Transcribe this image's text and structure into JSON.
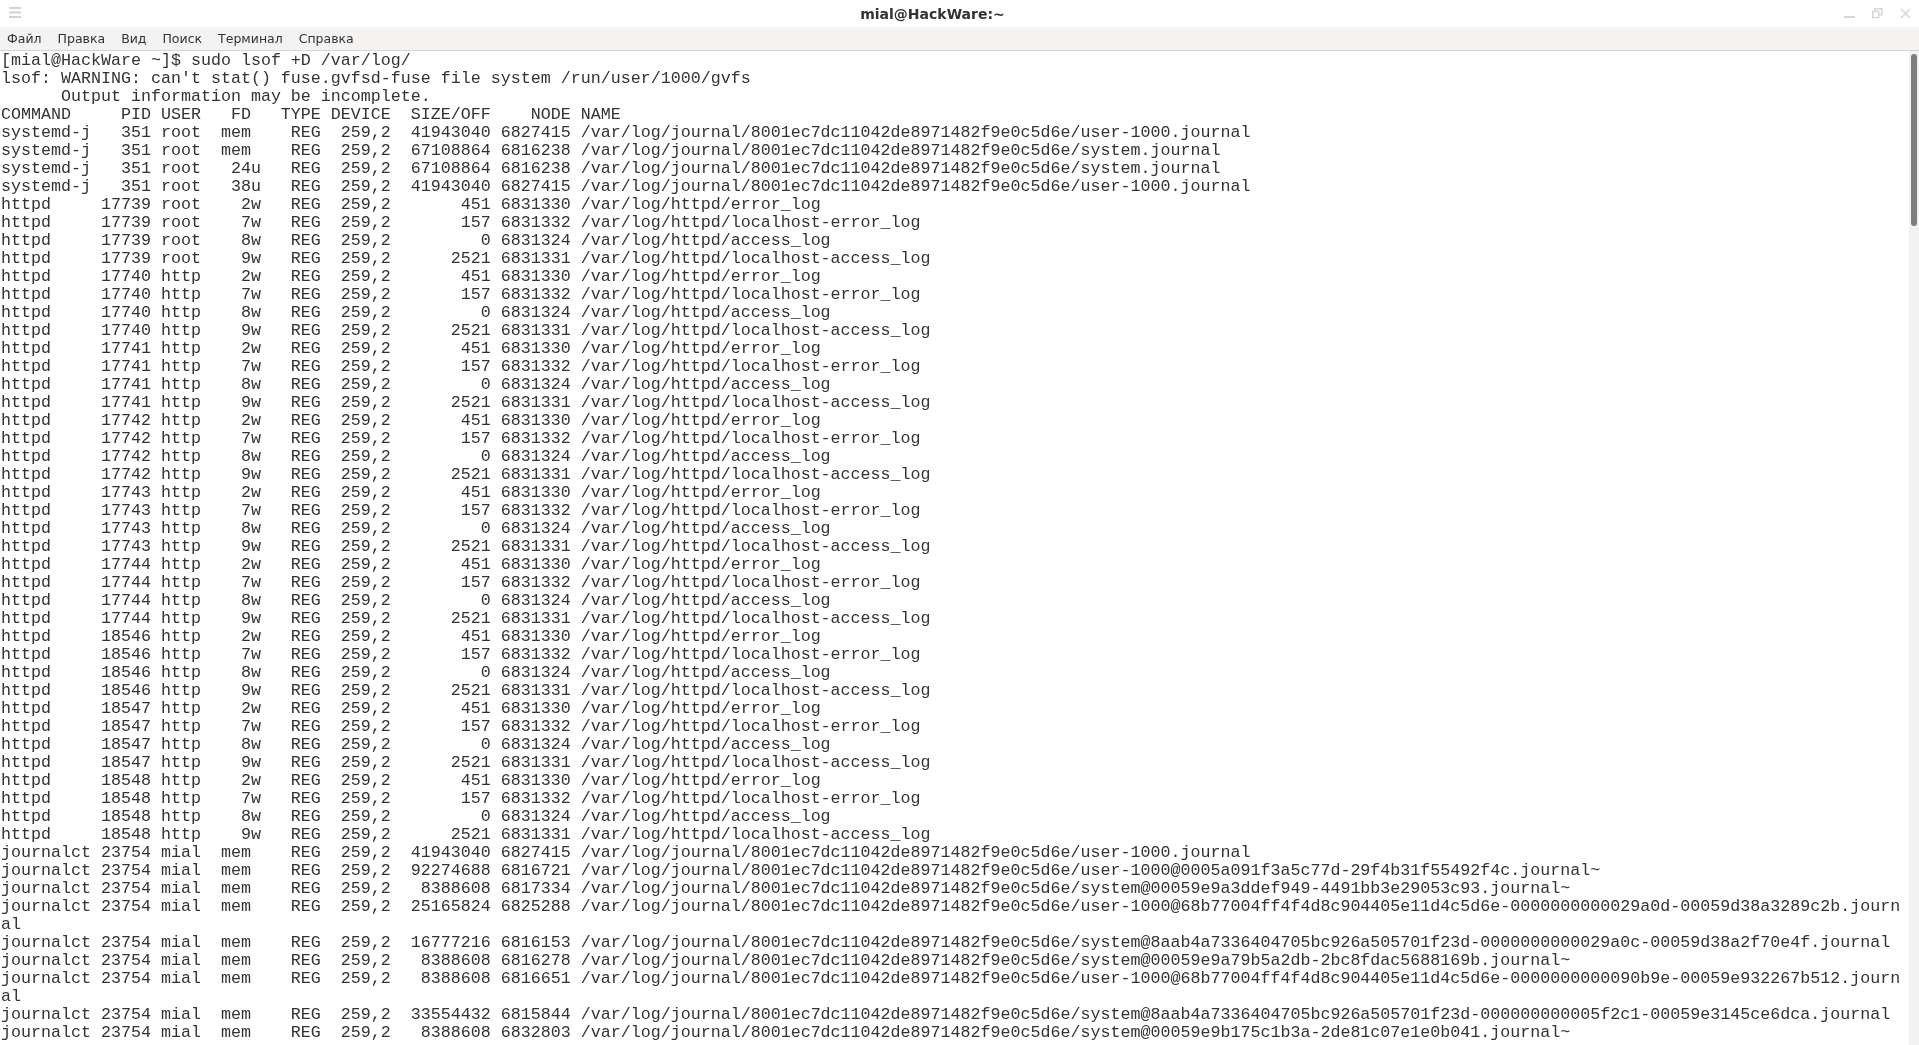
{
  "window": {
    "title": "mial@HackWare:~"
  },
  "menu": [
    "Файл",
    "Правка",
    "Вид",
    "Поиск",
    "Терминал",
    "Справка"
  ],
  "terminal": {
    "lines": [
      "[mial@HackWare ~]$ sudo lsof +D /var/log/",
      "lsof: WARNING: can't stat() fuse.gvfsd-fuse file system /run/user/1000/gvfs",
      "      Output information may be incomplete.",
      "COMMAND     PID USER   FD   TYPE DEVICE  SIZE/OFF    NODE NAME",
      "systemd-j   351 root  mem    REG  259,2  41943040 6827415 /var/log/journal/8001ec7dc11042de8971482f9e0c5d6e/user-1000.journal",
      "systemd-j   351 root  mem    REG  259,2  67108864 6816238 /var/log/journal/8001ec7dc11042de8971482f9e0c5d6e/system.journal",
      "systemd-j   351 root   24u   REG  259,2  67108864 6816238 /var/log/journal/8001ec7dc11042de8971482f9e0c5d6e/system.journal",
      "systemd-j   351 root   38u   REG  259,2  41943040 6827415 /var/log/journal/8001ec7dc11042de8971482f9e0c5d6e/user-1000.journal",
      "httpd     17739 root    2w   REG  259,2       451 6831330 /var/log/httpd/error_log",
      "httpd     17739 root    7w   REG  259,2       157 6831332 /var/log/httpd/localhost-error_log",
      "httpd     17739 root    8w   REG  259,2         0 6831324 /var/log/httpd/access_log",
      "httpd     17739 root    9w   REG  259,2      2521 6831331 /var/log/httpd/localhost-access_log",
      "httpd     17740 http    2w   REG  259,2       451 6831330 /var/log/httpd/error_log",
      "httpd     17740 http    7w   REG  259,2       157 6831332 /var/log/httpd/localhost-error_log",
      "httpd     17740 http    8w   REG  259,2         0 6831324 /var/log/httpd/access_log",
      "httpd     17740 http    9w   REG  259,2      2521 6831331 /var/log/httpd/localhost-access_log",
      "httpd     17741 http    2w   REG  259,2       451 6831330 /var/log/httpd/error_log",
      "httpd     17741 http    7w   REG  259,2       157 6831332 /var/log/httpd/localhost-error_log",
      "httpd     17741 http    8w   REG  259,2         0 6831324 /var/log/httpd/access_log",
      "httpd     17741 http    9w   REG  259,2      2521 6831331 /var/log/httpd/localhost-access_log",
      "httpd     17742 http    2w   REG  259,2       451 6831330 /var/log/httpd/error_log",
      "httpd     17742 http    7w   REG  259,2       157 6831332 /var/log/httpd/localhost-error_log",
      "httpd     17742 http    8w   REG  259,2         0 6831324 /var/log/httpd/access_log",
      "httpd     17742 http    9w   REG  259,2      2521 6831331 /var/log/httpd/localhost-access_log",
      "httpd     17743 http    2w   REG  259,2       451 6831330 /var/log/httpd/error_log",
      "httpd     17743 http    7w   REG  259,2       157 6831332 /var/log/httpd/localhost-error_log",
      "httpd     17743 http    8w   REG  259,2         0 6831324 /var/log/httpd/access_log",
      "httpd     17743 http    9w   REG  259,2      2521 6831331 /var/log/httpd/localhost-access_log",
      "httpd     17744 http    2w   REG  259,2       451 6831330 /var/log/httpd/error_log",
      "httpd     17744 http    7w   REG  259,2       157 6831332 /var/log/httpd/localhost-error_log",
      "httpd     17744 http    8w   REG  259,2         0 6831324 /var/log/httpd/access_log",
      "httpd     17744 http    9w   REG  259,2      2521 6831331 /var/log/httpd/localhost-access_log",
      "httpd     18546 http    2w   REG  259,2       451 6831330 /var/log/httpd/error_log",
      "httpd     18546 http    7w   REG  259,2       157 6831332 /var/log/httpd/localhost-error_log",
      "httpd     18546 http    8w   REG  259,2         0 6831324 /var/log/httpd/access_log",
      "httpd     18546 http    9w   REG  259,2      2521 6831331 /var/log/httpd/localhost-access_log",
      "httpd     18547 http    2w   REG  259,2       451 6831330 /var/log/httpd/error_log",
      "httpd     18547 http    7w   REG  259,2       157 6831332 /var/log/httpd/localhost-error_log",
      "httpd     18547 http    8w   REG  259,2         0 6831324 /var/log/httpd/access_log",
      "httpd     18547 http    9w   REG  259,2      2521 6831331 /var/log/httpd/localhost-access_log",
      "httpd     18548 http    2w   REG  259,2       451 6831330 /var/log/httpd/error_log",
      "httpd     18548 http    7w   REG  259,2       157 6831332 /var/log/httpd/localhost-error_log",
      "httpd     18548 http    8w   REG  259,2         0 6831324 /var/log/httpd/access_log",
      "httpd     18548 http    9w   REG  259,2      2521 6831331 /var/log/httpd/localhost-access_log",
      "journalct 23754 mial  mem    REG  259,2  41943040 6827415 /var/log/journal/8001ec7dc11042de8971482f9e0c5d6e/user-1000.journal",
      "journalct 23754 mial  mem    REG  259,2  92274688 6816721 /var/log/journal/8001ec7dc11042de8971482f9e0c5d6e/user-1000@0005a091f3a5c77d-29f4b31f55492f4c.journal~",
      "journalct 23754 mial  mem    REG  259,2   8388608 6817334 /var/log/journal/8001ec7dc11042de8971482f9e0c5d6e/system@00059e9a3ddef949-4491bb3e29053c93.journal~",
      "journalct 23754 mial  mem    REG  259,2  25165824 6825288 /var/log/journal/8001ec7dc11042de8971482f9e0c5d6e/user-1000@68b77004ff4f4d8c904405e11d4c5d6e-0000000000029a0d-00059d38a3289c2b.journ",
      "al",
      "journalct 23754 mial  mem    REG  259,2  16777216 6816153 /var/log/journal/8001ec7dc11042de8971482f9e0c5d6e/system@8aab4a7336404705bc926a505701f23d-0000000000029a0c-00059d38a2f70e4f.journal",
      "journalct 23754 mial  mem    REG  259,2   8388608 6816278 /var/log/journal/8001ec7dc11042de8971482f9e0c5d6e/system@00059e9a79b5a2db-2bc8fdac5688169b.journal~",
      "journalct 23754 mial  mem    REG  259,2   8388608 6816651 /var/log/journal/8001ec7dc11042de8971482f9e0c5d6e/user-1000@68b77004ff4f4d8c904405e11d4c5d6e-0000000000090b9e-00059e932267b512.journ",
      "al",
      "journalct 23754 mial  mem    REG  259,2  33554432 6815844 /var/log/journal/8001ec7dc11042de8971482f9e0c5d6e/system@8aab4a7336404705bc926a505701f23d-000000000005f2c1-00059e3145ce6dca.journal",
      "journalct 23754 mial  mem    REG  259,2   8388608 6832803 /var/log/journal/8001ec7dc11042de8971482f9e0c5d6e/system@00059e9b175c1b3a-2de81c07e1e0b041.journal~"
    ]
  }
}
